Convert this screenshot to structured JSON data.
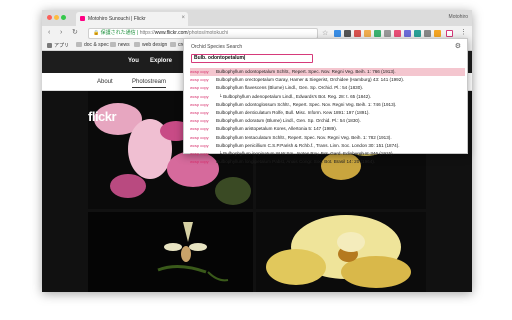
{
  "browser": {
    "tab_title": "Motohiro Sunouchi | Flickr",
    "window_user": "Motohiro",
    "nav": {
      "back": "‹",
      "forward": "›",
      "reload": "↻"
    },
    "url": {
      "security": "保護された通信",
      "protocol": "https://",
      "host": "www.flickr.com",
      "path": "/photos/motokuchi"
    },
    "bookmarks": [
      {
        "label": "アプリ"
      },
      {
        "label": "doc & spec"
      },
      {
        "label": "news"
      },
      {
        "label": "web design"
      },
      {
        "label": "creat"
      }
    ],
    "colors": {
      "close": "#fc605b",
      "minimize": "#fdbc40",
      "maximize": "#34c84a"
    }
  },
  "flickr": {
    "logo": "flickr",
    "nav": [
      {
        "label": "You"
      },
      {
        "label": "Explore"
      }
    ],
    "subnav": [
      {
        "label": "About"
      },
      {
        "label": "Photostream"
      }
    ],
    "brand_pink": "#ff0084"
  },
  "popup": {
    "title": "Orchid Species Search",
    "query": "Bulb. odontopetalum|",
    "wcsp_label": "wcsp copy",
    "results": [
      {
        "indent": false,
        "text": "Bulbophyllum odontopetalum Schltr., Repert. Spec. Nov. Regni Veg. Beih. 1: 766 (1913).",
        "selected": true
      },
      {
        "indent": false,
        "text": "Bulbophyllum orectopetalum Garay, Hamer & Siegerist, Orchidee (Hamburg) 43: 141 (1992).",
        "selected": false
      },
      {
        "indent": false,
        "text": "Bulbophyllum flavescens (Blume) Lindl., Gen. Sp. Orchid. Pl.: 54 (1830).",
        "selected": false
      },
      {
        "indent": true,
        "text": "Bulbophyllum adenopetalum Lindl., Edwards's Bot. Reg. 28: t. 65 (1842).",
        "selected": false
      },
      {
        "indent": false,
        "text": "Bulbophyllum odontoglossum Schltr., Repert. Spec. Nov. Regni Veg. Beih. 1: 746 (1913).",
        "selected": false
      },
      {
        "indent": false,
        "text": "Bulbophyllum denticulatum Rolfe, Bull. Misc. Inform. Kew 1891: 197 (1891).",
        "selected": false
      },
      {
        "indent": false,
        "text": "Bulbophyllum odoratum (Blume) Lindl., Gen. Sp. Orchid. Pl.: 54 (1830).",
        "selected": false
      },
      {
        "indent": false,
        "text": "Bulbophyllum aristopetalum Kores, Allertonia 5: 147 (1989).",
        "selected": false
      },
      {
        "indent": false,
        "text": "Bulbophyllum tentaculatum Schltr., Repert. Spec. Nov. Regni Veg. Beih. 1: 782 (1913).",
        "selected": false
      },
      {
        "indent": false,
        "text": "Bulbophyllum penicillium C.S.P.Parish & Rchb.f., Trans. Linn. Soc. London 30: 151 (1874).",
        "selected": false
      },
      {
        "indent": true,
        "text": "Bulbophyllum inopinatum W.W.Sm., Notes Roy. Bot. Gard. Edinburgh 8: 346 (1915).",
        "selected": false
      },
      {
        "indent": false,
        "text": "Bulbophyllum longipetalum Pabst, Anais Congr. Soc. Bot. Brasil 14: 20 (1964).",
        "selected": false
      }
    ]
  }
}
